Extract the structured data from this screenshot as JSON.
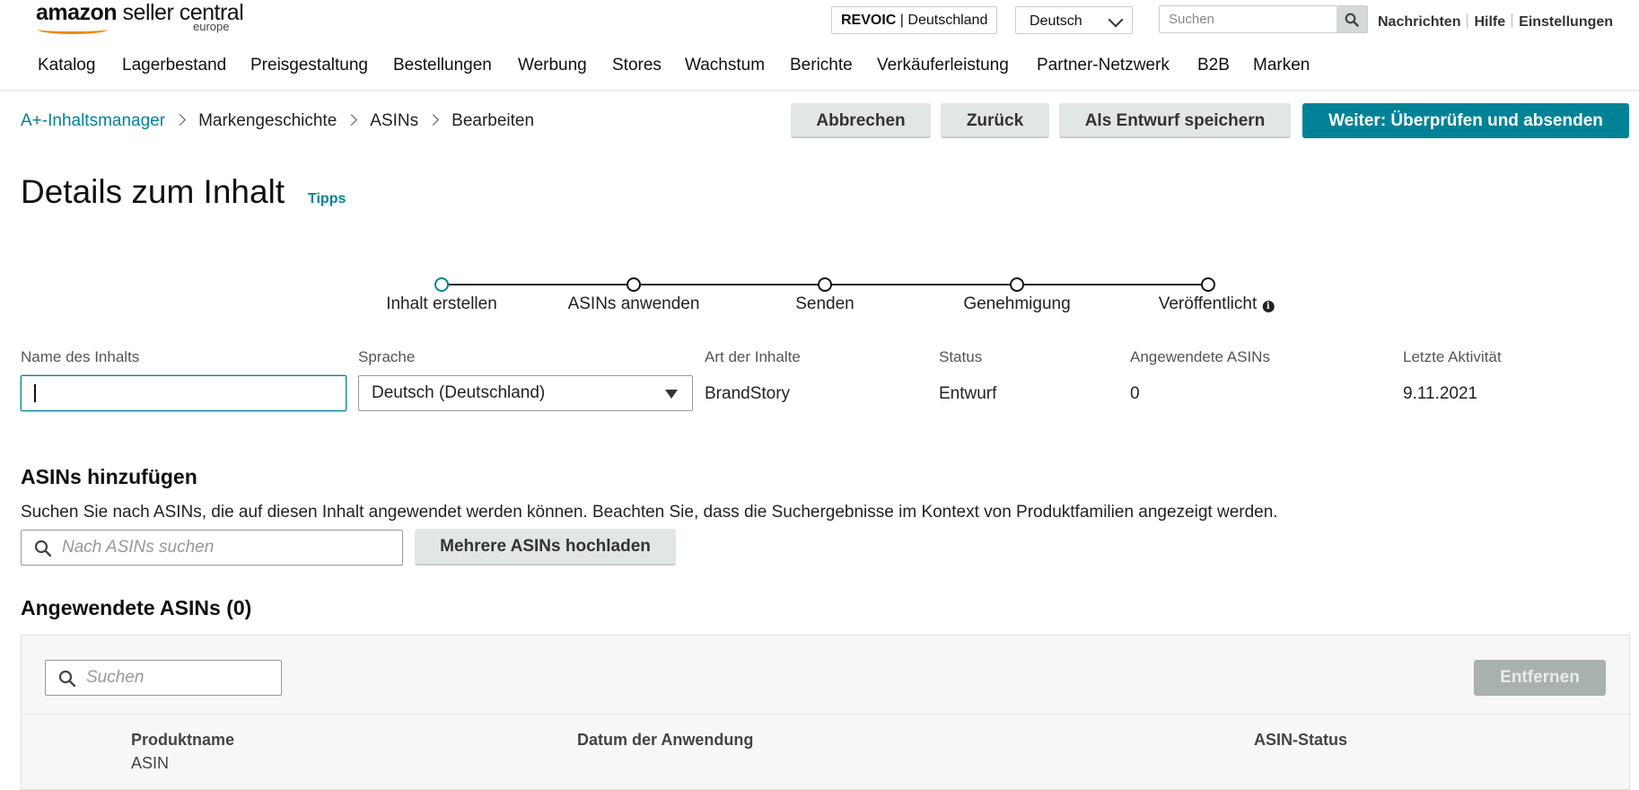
{
  "header": {
    "logo_brand_bold": "amazon",
    "logo_brand_light": " seller central",
    "logo_region": "europe",
    "account_name": "REVOIC",
    "account_marketplace": "Deutschland",
    "language": "Deutsch",
    "search_placeholder": "Suchen",
    "links": [
      "Nachrichten",
      "Hilfe",
      "Einstellungen"
    ]
  },
  "nav": {
    "items": [
      "Katalog",
      "Lagerbestand",
      "Preisgestaltung",
      "Bestellungen",
      "Werbung",
      "Stores",
      "Wachstum",
      "Berichte",
      "Verkäuferleistung",
      "Partner-Netzwerk",
      "B2B",
      "Marken"
    ]
  },
  "breadcrumb": {
    "items": [
      "A+-Inhaltsmanager",
      "Markengeschichte",
      "ASINs",
      "Bearbeiten"
    ]
  },
  "actions": {
    "cancel": "Abbrechen",
    "back": "Zurück",
    "save_draft": "Als Entwurf speichern",
    "next": "Weiter: Überprüfen und absenden"
  },
  "page": {
    "title": "Details zum Inhalt",
    "tips": "Tipps"
  },
  "stepper": {
    "steps": [
      "Inhalt erstellen",
      "ASINs anwenden",
      "Senden",
      "Genehmigung",
      "Veröffentlicht"
    ],
    "active_index": 0
  },
  "details": {
    "name_label": "Name des Inhalts",
    "name_value": "",
    "language_label": "Sprache",
    "language_value": "Deutsch (Deutschland)",
    "type_label": "Art der Inhalte",
    "type_value": "BrandStory",
    "status_label": "Status",
    "status_value": "Entwurf",
    "asins_label": "Angewendete ASINs",
    "asins_value": "0",
    "activity_label": "Letzte Aktivität",
    "activity_value": "9.11.2021"
  },
  "add_asins": {
    "heading": "ASINs hinzufügen",
    "description": "Suchen Sie nach ASINs, die auf diesen Inhalt angewendet werden können. Beachten Sie, dass die Suchergebnisse im Kontext von Produktfamilien angezeigt werden.",
    "search_placeholder": "Nach ASINs suchen",
    "upload_label": "Mehrere ASINs hochladen"
  },
  "applied": {
    "heading": "Angewendete ASINs (0)",
    "search_placeholder": "Suchen",
    "remove_label": "Entfernen",
    "columns": {
      "product": "Produktname",
      "product_sub": "ASIN",
      "date": "Datum der Anwendung",
      "status": "ASIN-Status"
    }
  },
  "colors": {
    "accent": "#008296",
    "secondary_button": "#e3e6e6",
    "disabled_button": "#a9b0b0"
  }
}
